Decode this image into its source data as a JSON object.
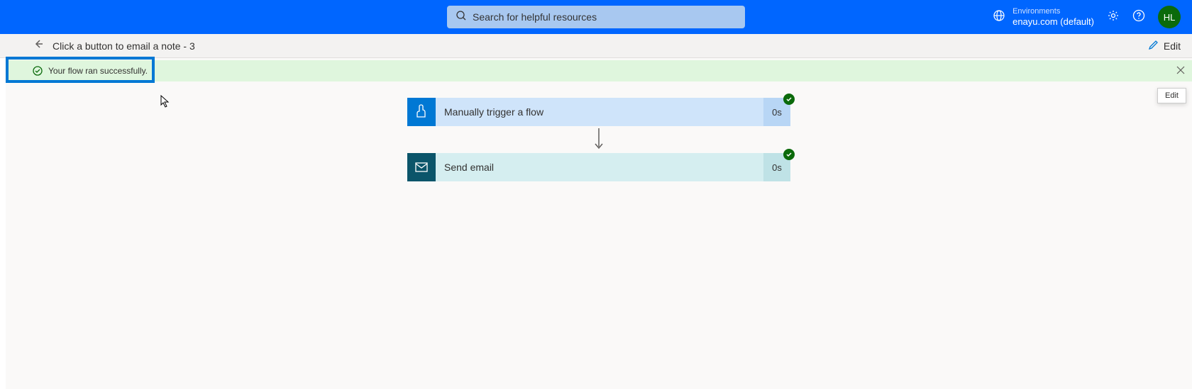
{
  "header": {
    "search_placeholder": "Search for helpful resources",
    "env_label": "Environments",
    "env_name": "enayu.com (default)",
    "avatar_initials": "HL"
  },
  "breadcrumb": {
    "title": "Click a button to email a note - 3",
    "edit_label": "Edit"
  },
  "banner": {
    "success_message": "Your flow ran successfully."
  },
  "tooltip": {
    "text": "Edit"
  },
  "flow": {
    "steps": [
      {
        "label": "Manually trigger a flow",
        "duration": "0s",
        "icon": "trigger"
      },
      {
        "label": "Send email",
        "duration": "0s",
        "icon": "email"
      }
    ]
  },
  "colors": {
    "brand_blue": "#0066ff",
    "success_green": "#0b6a0b",
    "success_bg": "#dff6dd",
    "trigger_icon_bg": "#0078d4",
    "email_icon_bg": "#0b556a"
  }
}
